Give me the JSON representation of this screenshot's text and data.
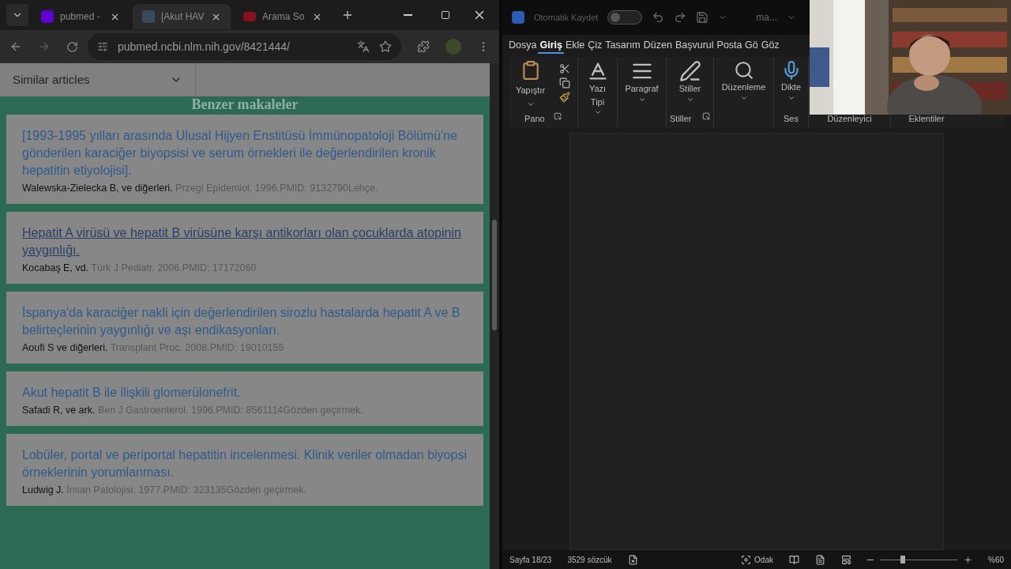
{
  "browser": {
    "tabs": [
      {
        "title": "pubmed -",
        "selected": false,
        "kind": "yahoo"
      },
      {
        "title": "[Akut HAV",
        "selected": true,
        "kind": "doc"
      },
      {
        "title": "Arama So",
        "selected": false,
        "kind": "red"
      }
    ],
    "url": "pubmed.ncbi.nlm.nih.gov/8421444/",
    "section_dropdown": "Similar articles",
    "heading": "Benzer makaleler",
    "articles": [
      {
        "title": "[1993-1995 yılları arasında Ulusal Hijyen Enstitüsü İmmünopatoloji Bölümü'ne gönderilen karaciğer biyopsisi ve serum örnekleri ile değerlendirilen kronik hepatitin etiyolojisi].",
        "authors": "Walewska-Zielecka B, ve diğerleri.",
        "source": "Przegl Epidemiol. 1996.PMID: 9132790Lehçe.",
        "hovered": false
      },
      {
        "title": "Hepatit A virüsü ve hepatit B virüsüne karşı antikorları olan çocuklarda atopinin yaygınlığı.",
        "authors": "Kocabaş E, vd.",
        "source": "Türk J Pediatr. 2006.PMID: 17172060",
        "hovered": true
      },
      {
        "title": "İspanya'da karaciğer nakli için değerlendirilen sirozlu hastalarda hepatit A ve B belirteçlerinin yaygınlığı ve aşı endikasyonları.",
        "authors": "Aoufi S ve diğerleri.",
        "source": "Transplant Proc. 2008.PMID: 19010155",
        "hovered": false
      },
      {
        "title": "Akut hepatit B ile ilişkili glomerülonefrit.",
        "authors": "Safadi R, ve ark.",
        "source": "Ben J Gastroenterol. 1996.PMID: 8561114Gözden geçirmek.",
        "hovered": false
      },
      {
        "title": "Lobüler, portal ve periportal hepatitin incelenmesi. Klinik veriler olmadan biyopsi örneklerinin yorumlanması.",
        "authors": "Ludwig J.",
        "source": "İnsan Patolojisi. 1977.PMID: 323135Gözden geçirmek.",
        "hovered": false
      }
    ]
  },
  "word": {
    "autosave": {
      "label": "Otomatik Kaydet",
      "on": false
    },
    "doc_title": "ma...",
    "menu": [
      {
        "label": "Dosya",
        "selected": false
      },
      {
        "label": "Giriş",
        "selected": true
      },
      {
        "label": "Ekle",
        "selected": false
      },
      {
        "label": "Çiz",
        "selected": false
      },
      {
        "label": "Tasarım",
        "selected": false
      },
      {
        "label": "Düzen",
        "selected": false
      },
      {
        "label": "Başvurul",
        "selected": false
      },
      {
        "label": "Posta Gö",
        "selected": false
      },
      {
        "label": "Göz",
        "selected": false
      }
    ],
    "ribbon": {
      "paste": "Yapıştır",
      "font": [
        "Yazı",
        "Tipi"
      ],
      "paragraph": "Paragraf",
      "styles": "Stiller",
      "editing": "Düzenleme",
      "dictate": "Dikte",
      "groups": [
        "Pano",
        "Stiller",
        "Ses",
        "Düzenleyici",
        "Eklentiler"
      ]
    },
    "status": {
      "page": "Sayfa 18/23",
      "words": "3529 sözcük",
      "focus": "Odak",
      "zoom": {
        "label": "%60",
        "level": 0.3
      }
    }
  }
}
